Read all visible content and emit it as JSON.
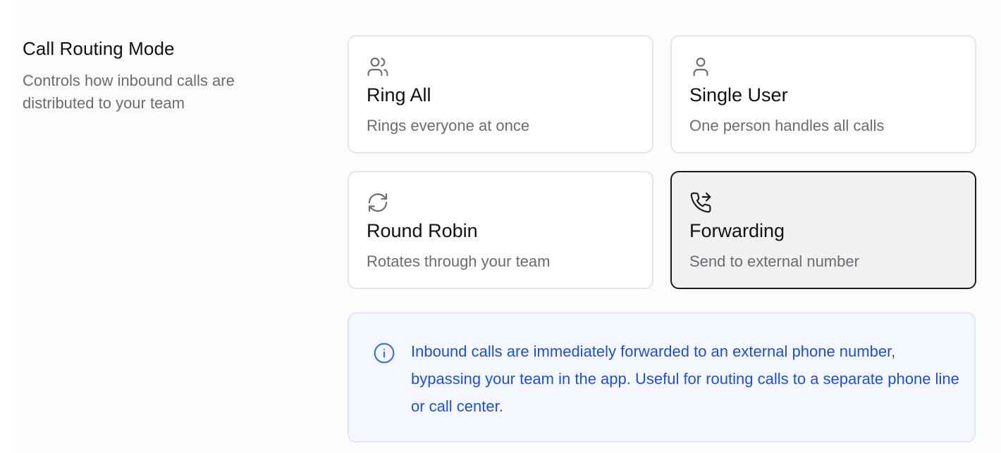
{
  "section": {
    "title": "Call Routing Mode",
    "description": "Controls how inbound calls are distributed to your team"
  },
  "options": [
    {
      "title": "Ring All",
      "description": "Rings everyone at once",
      "icon": "users-icon",
      "selected": false
    },
    {
      "title": "Single User",
      "description": "One person handles all calls",
      "icon": "user-icon",
      "selected": false
    },
    {
      "title": "Round Robin",
      "description": "Rotates through your team",
      "icon": "refresh-icon",
      "selected": false
    },
    {
      "title": "Forwarding",
      "description": "Send to external number",
      "icon": "phone-forward-icon",
      "selected": true
    }
  ],
  "info": {
    "icon": "info-icon",
    "text": "Inbound calls are immediately forwarded to an external phone number, bypassing your team in the app. Useful for routing calls to a separate phone line or call center."
  },
  "colors": {
    "accent_blue": "#1f4fd0",
    "selected_border": "#1a1a1a",
    "muted_text": "#6b6b73"
  }
}
